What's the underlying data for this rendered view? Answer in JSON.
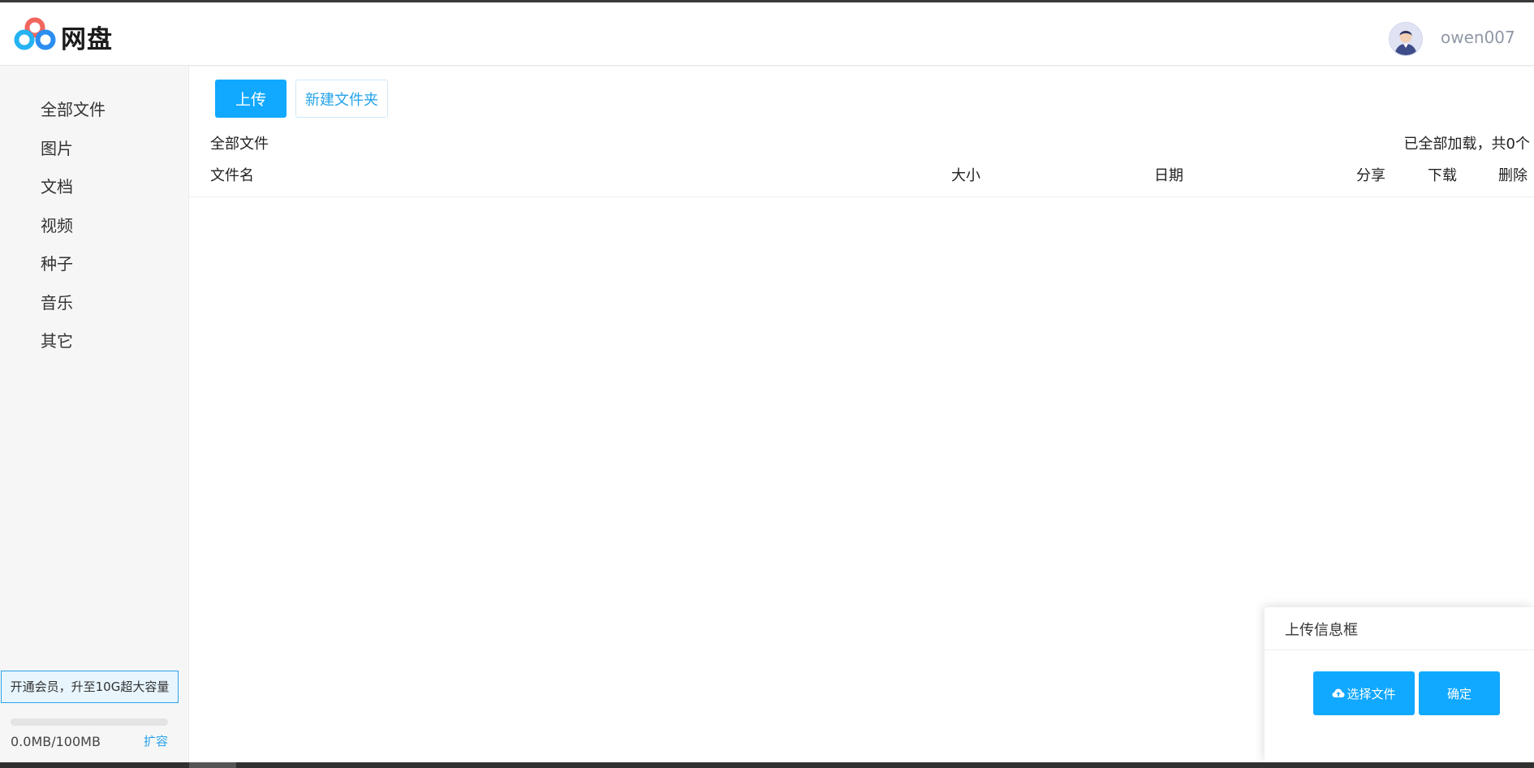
{
  "header": {
    "brand": "网盘",
    "username": "owen007"
  },
  "sidebar": {
    "items": [
      {
        "label": "全部文件"
      },
      {
        "label": "图片"
      },
      {
        "label": "文档"
      },
      {
        "label": "视频"
      },
      {
        "label": "种子"
      },
      {
        "label": "音乐"
      },
      {
        "label": "其它"
      }
    ],
    "vip_banner": "开通会员，升至10G超大容量",
    "storage_text": "0.0MB/100MB",
    "storage_used_fraction": 0,
    "expand_label": "扩容"
  },
  "toolbar": {
    "upload_label": "上传",
    "new_folder_label": "新建文件夹"
  },
  "file_list": {
    "breadcrumb": "全部文件",
    "loaded_status": "已全部加载，共0个",
    "columns": [
      "文件名",
      "大小",
      "日期",
      "分享",
      "下载",
      "删除"
    ],
    "rows": []
  },
  "upload_panel": {
    "title": "上传信息框",
    "choose_label": "选择文件",
    "confirm_label": "确定"
  },
  "colors": {
    "accent": "#11a8ff",
    "link": "#2aa3ea",
    "sidebar_bg": "#f6f6f6"
  }
}
